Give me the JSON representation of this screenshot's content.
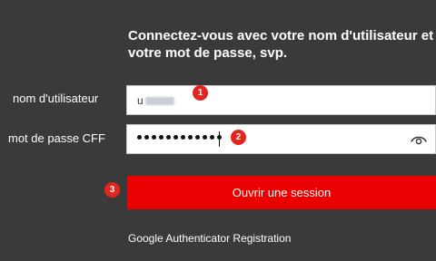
{
  "login": {
    "instructions": {
      "line1": "Connectez-vous avec votre nom d'utilisateur et",
      "line2": "votre mot de passe, svp."
    },
    "username": {
      "label": "nom d'utilisateur",
      "value_visible": "u",
      "value_blurred": "123962"
    },
    "password": {
      "label": "mot de passe CFF",
      "masked_length": 12,
      "show_password_icon": "eye-icon"
    },
    "submit_label": "Ouvrir une session",
    "google_link_label": "Google Authenticator Registration",
    "markers": [
      "1",
      "2",
      "3"
    ]
  },
  "colors": {
    "background": "#3a3a3a",
    "accent": "#eb0000",
    "marker": "#e2251f",
    "text": "#ffffff"
  }
}
